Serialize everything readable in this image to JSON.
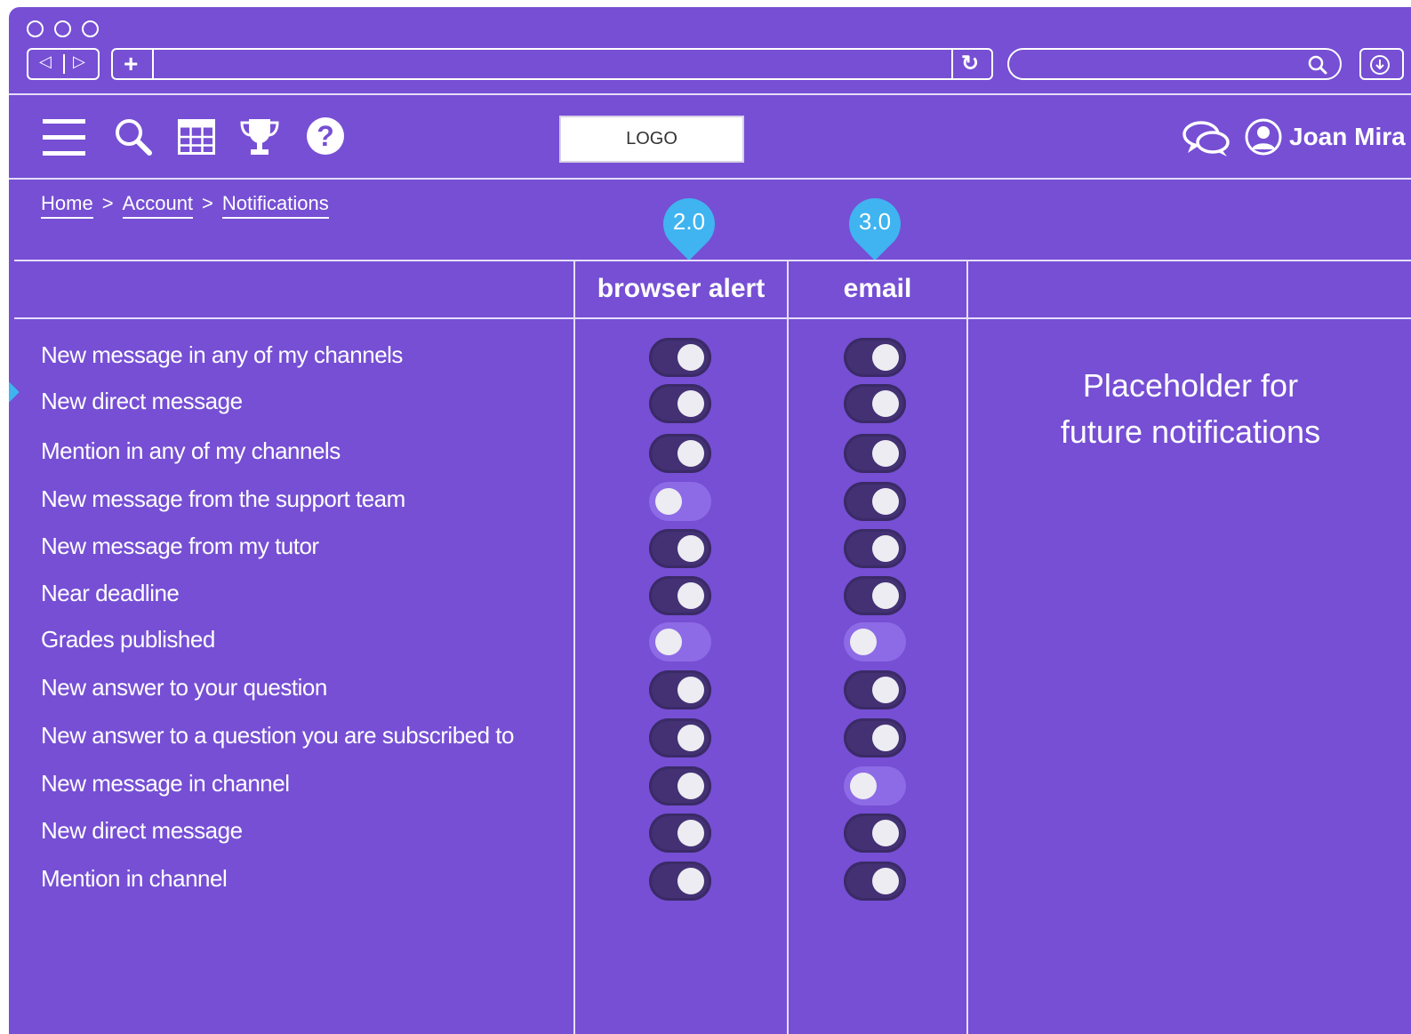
{
  "browser": {
    "back_glyph": "◁",
    "forward_glyph": "▷",
    "new_tab_glyph": "+",
    "reload_glyph": "↻",
    "url": "",
    "search_value": ""
  },
  "header": {
    "logo": "LOGO",
    "user_name": "Joan Mira",
    "help_glyph": "?"
  },
  "breadcrumb": {
    "items": [
      "Home",
      "Account",
      "Notifications"
    ],
    "separator": ">"
  },
  "columns": {
    "browser_alert": "browser alert",
    "email": "email"
  },
  "pins": {
    "browser_alert": "2.0",
    "email": "3.0"
  },
  "placeholder": {
    "line1": "Placeholder for",
    "line2": "future notifications"
  },
  "rows": [
    {
      "label": "New message in any of my channels",
      "browser": true,
      "email": true
    },
    {
      "label": "New direct message",
      "browser": true,
      "email": true
    },
    {
      "label": "Mention in any of my channels",
      "browser": true,
      "email": true
    },
    {
      "label": "New message from the support team",
      "browser": false,
      "email": true
    },
    {
      "label": "New message from my tutor",
      "browser": true,
      "email": true
    },
    {
      "label": "Near deadline",
      "browser": true,
      "email": true
    },
    {
      "label": "Grades published",
      "browser": false,
      "email": false
    },
    {
      "label": "New answer to your question",
      "browser": true,
      "email": true
    },
    {
      "label": "New answer to a question you are subscribed to",
      "browser": true,
      "email": true
    },
    {
      "label": "New message in channel",
      "browser": true,
      "email": false
    },
    {
      "label": "New direct message",
      "browser": true,
      "email": true
    },
    {
      "label": "Mention in channel",
      "browser": true,
      "email": true
    }
  ],
  "colors": {
    "background": "#764fd4",
    "toggle_on": "#433174",
    "toggle_off": "#8d6be6",
    "pin": "#3fb4f0"
  }
}
